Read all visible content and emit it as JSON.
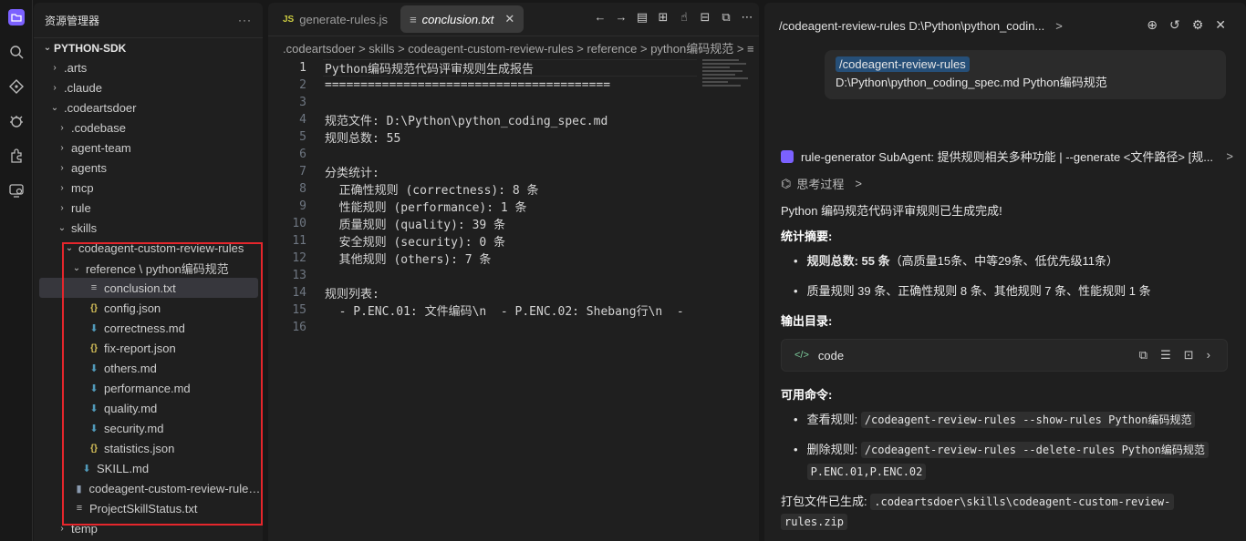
{
  "explorer": {
    "title": "资源管理器",
    "more": "···",
    "root": "PYTHON-SDK",
    "items": [
      {
        "label": ".arts",
        "type": "folder",
        "open": false,
        "depth": 1
      },
      {
        "label": ".claude",
        "type": "folder",
        "open": false,
        "depth": 1
      },
      {
        "label": ".codeartsdoer",
        "type": "folder",
        "open": true,
        "depth": 1
      },
      {
        "label": ".codebase",
        "type": "folder",
        "open": false,
        "depth": 2
      },
      {
        "label": "agent-team",
        "type": "folder",
        "open": false,
        "depth": 2
      },
      {
        "label": "agents",
        "type": "folder",
        "open": false,
        "depth": 2
      },
      {
        "label": "mcp",
        "type": "folder",
        "open": false,
        "depth": 2
      },
      {
        "label": "rule",
        "type": "folder",
        "open": false,
        "depth": 2
      },
      {
        "label": "skills",
        "type": "folder",
        "open": true,
        "depth": 2
      },
      {
        "label": "codeagent-custom-review-rules",
        "type": "folder",
        "open": true,
        "depth": 3
      },
      {
        "label": "reference \\ python编码规范",
        "type": "folder",
        "open": true,
        "depth": 4
      },
      {
        "label": "conclusion.txt",
        "type": "txt",
        "depth": 5,
        "selected": true
      },
      {
        "label": "config.json",
        "type": "json",
        "depth": 5
      },
      {
        "label": "correctness.md",
        "type": "md",
        "depth": 5
      },
      {
        "label": "fix-report.json",
        "type": "json",
        "depth": 5
      },
      {
        "label": "others.md",
        "type": "md",
        "depth": 5
      },
      {
        "label": "performance.md",
        "type": "md",
        "depth": 5
      },
      {
        "label": "quality.md",
        "type": "md",
        "depth": 5
      },
      {
        "label": "security.md",
        "type": "md",
        "depth": 5
      },
      {
        "label": "statistics.json",
        "type": "json",
        "depth": 5
      },
      {
        "label": "SKILL.md",
        "type": "md",
        "depth": 4
      },
      {
        "label": "codeagent-custom-review-rules...",
        "type": "zip",
        "depth": 3
      },
      {
        "label": "ProjectSkillStatus.txt",
        "type": "txt",
        "depth": 3
      },
      {
        "label": "temp",
        "type": "folder",
        "open": false,
        "depth": 2
      }
    ]
  },
  "editor": {
    "tabs": [
      {
        "label": "generate-rules.js",
        "icon": "JS",
        "active": false
      },
      {
        "label": "conclusion.txt",
        "icon": "≡",
        "active": true,
        "close": "✕"
      }
    ],
    "breadcrumb": ".codeartsdoer > skills > codeagent-custom-review-rules > reference > python编码规范 > ≡",
    "lines": [
      "Python编码规范代码评审规则生成报告",
      "========================================",
      "",
      "规范文件: D:\\Python\\python_coding_spec.md",
      "规则总数: 55",
      "",
      "分类统计:",
      "  正确性规则 (correctness): 8 条",
      "  性能规则 (performance): 1 条",
      "  质量规则 (quality): 39 条",
      "  安全规则 (security): 0 条",
      "  其他规则 (others): 7 条",
      "",
      "规则列表:",
      "  - P.ENC.01: 文件编码\\n  - P.ENC.02: Shebang行\\n  - ",
      ""
    ],
    "line_numbers": [
      "1",
      "2",
      "3",
      "4",
      "5",
      "6",
      "7",
      "8",
      "9",
      "10",
      "11",
      "12",
      "13",
      "14",
      "15",
      "16"
    ]
  },
  "chat": {
    "header_title": "/codeagent-review-rules D:\\Python\\python_codin...",
    "header_chevron": ">",
    "user_cmd": "/codeagent-review-rules",
    "user_args": "D:\\Python\\python_coding_spec.md Python编码规范",
    "agent_line": "rule-generator SubAgent: 提供规则相关多种功能 | --generate <文件路径> [规...",
    "agent_chevron": ">",
    "thinking": "思考过程",
    "thinking_chevron": ">",
    "done": "Python 编码规范代码评审规则已生成完成!",
    "summary_title": "统计摘要:",
    "summary_1_label": "规则总数:",
    "summary_1_value": "55 条",
    "summary_1_rest": "（高质量15条、中等29条、低优先级11条）",
    "summary_2": "质量规则 39 条、正确性规则 8 条、其他规则 7 条、性能规则 1 条",
    "output_title": "输出目录:",
    "output_dir": "code",
    "commands_title": "可用命令:",
    "cmd_view_label": "查看规则:",
    "cmd_view": "/codeagent-review-rules --show-rules Python编码规范",
    "cmd_delete_label": "删除规则:",
    "cmd_delete_1": "/codeagent-review-rules --delete-rules Python编码规范",
    "cmd_delete_2": "P.ENC.01,P.ENC.02",
    "pack_label": "打包文件已生成:",
    "pack_path_1": ".codeartsdoer\\skills\\codeagent-custom-review-",
    "pack_path_2": "rules.zip"
  }
}
